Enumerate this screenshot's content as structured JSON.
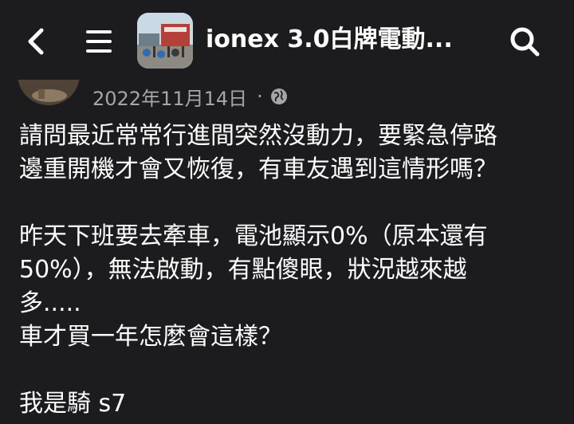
{
  "header": {
    "title": "ionex 3.0白牌電動...",
    "back_icon": "chevron-left-icon",
    "menu_icon": "hamburger-menu-icon",
    "search_icon": "search-icon"
  },
  "post": {
    "date": "2022年11月14日",
    "separator": "·",
    "privacy_icon": "globe-icon",
    "lines": [
      "請問最近常常行進間突然沒動力，要緊急停路",
      "邊重開機才會又恢復，有車友遇到這情形嗎？",
      "",
      "昨天下班要去牽車，電池顯示0%（原本還有",
      "50%），無法啟動，有點傻眼，狀況越來越",
      "多.....",
      "車才買一年怎麼會這樣？",
      "",
      "我是騎 s7"
    ]
  },
  "colors": {
    "background": "#1c1c1e",
    "text": "#ffffff",
    "meta_text": "#a5a5aa"
  }
}
